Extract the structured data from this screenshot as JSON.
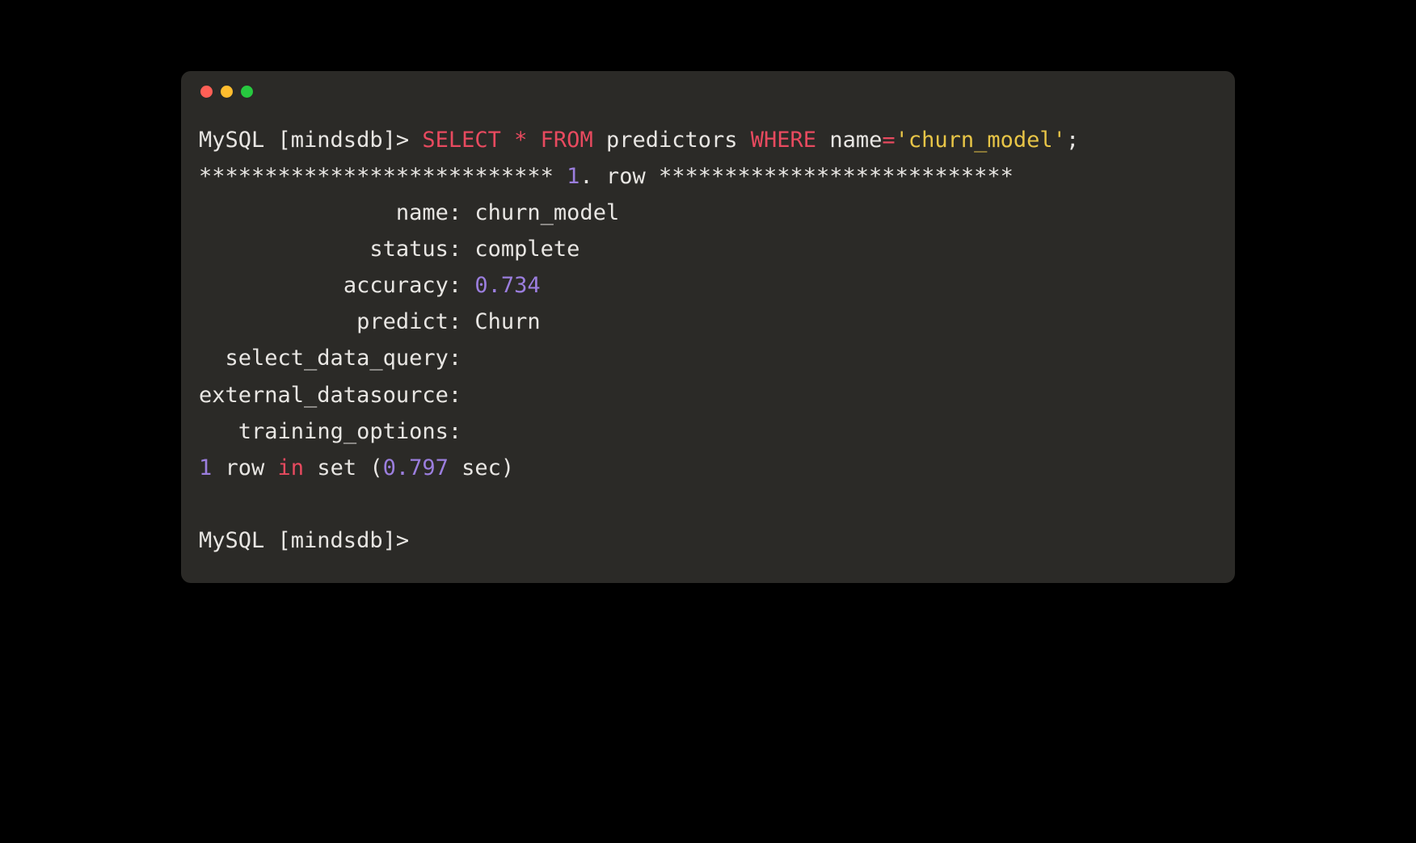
{
  "prompt1": {
    "prefix": "MySQL [mindsdb]> ",
    "kw_select": "SELECT",
    "star": " * ",
    "kw_from": "FROM",
    "table": " predictors ",
    "kw_where": "WHERE",
    "col": " name",
    "eq": "=",
    "str": "'churn_model'",
    "semi": ";"
  },
  "row_header": {
    "stars_left": "*************************** ",
    "num": "1",
    "mid": ". row ",
    "stars_right": "***************************"
  },
  "fields": {
    "name": {
      "label": "name",
      "value": "churn_model"
    },
    "status": {
      "label": "status",
      "value": "complete"
    },
    "accuracy": {
      "label": "accuracy",
      "value": "0.734"
    },
    "predict": {
      "label": "predict",
      "value": "Churn"
    },
    "select_data_query": {
      "label": "select_data_query",
      "value": ""
    },
    "external_datasource": {
      "label": "external_datasource",
      "value": ""
    },
    "training_options": {
      "label": "training_options",
      "value": ""
    }
  },
  "summary": {
    "num_rows": "1",
    "row_word": " row ",
    "in": "in",
    "set_word": " set ",
    "lparen": "(",
    "time": "0.797",
    "sec": " sec)"
  },
  "prompt2": "MySQL [mindsdb]> "
}
